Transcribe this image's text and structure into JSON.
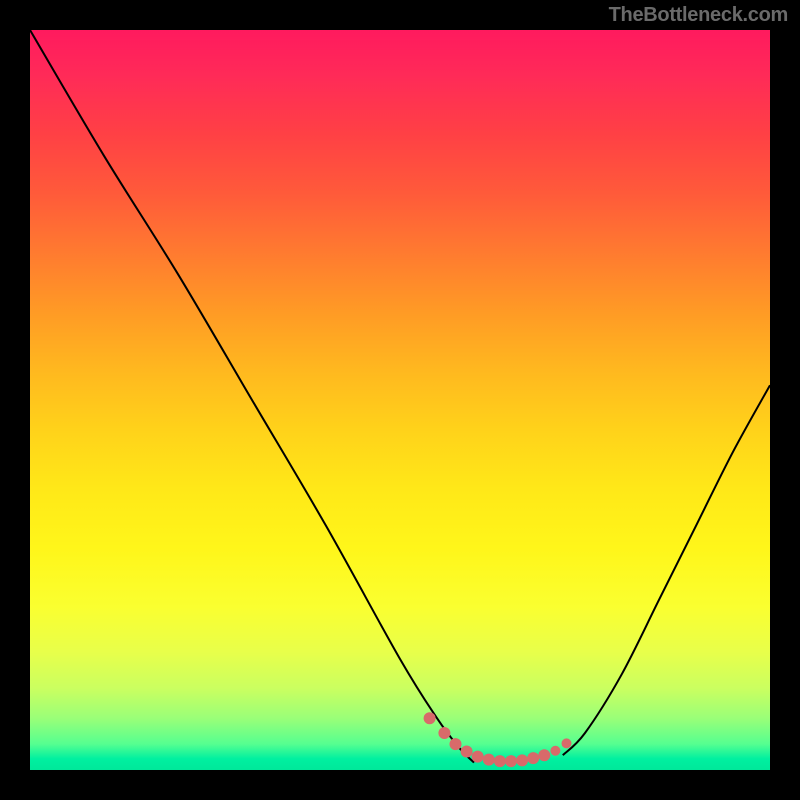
{
  "watermark": "TheBottleneck.com",
  "chart_data": {
    "type": "line",
    "title": "",
    "xlabel": "",
    "ylabel": "",
    "xlim": [
      0,
      100
    ],
    "ylim": [
      0,
      100
    ],
    "background_gradient": {
      "orientation": "vertical",
      "stops": [
        {
          "pos": 0.0,
          "color": "#ff1a5e"
        },
        {
          "pos": 0.3,
          "color": "#ff7a30"
        },
        {
          "pos": 0.62,
          "color": "#ffe818"
        },
        {
          "pos": 0.84,
          "color": "#e8ff4a"
        },
        {
          "pos": 0.965,
          "color": "#55ff90"
        },
        {
          "pos": 1.0,
          "color": "#00e89a"
        }
      ]
    },
    "series": [
      {
        "name": "left-branch",
        "x": [
          0,
          10,
          20,
          30,
          40,
          50,
          55,
          58,
          60
        ],
        "y": [
          100,
          83,
          67,
          50,
          33,
          15,
          7,
          3,
          1
        ]
      },
      {
        "name": "right-branch",
        "x": [
          72,
          75,
          80,
          85,
          90,
          95,
          100
        ],
        "y": [
          2,
          5,
          13,
          23,
          33,
          43,
          52
        ]
      }
    ],
    "dots": {
      "name": "valley-dots",
      "color": "#d86a6a",
      "points": [
        {
          "x": 54,
          "y": 7,
          "r": 6
        },
        {
          "x": 56,
          "y": 5,
          "r": 6
        },
        {
          "x": 57.5,
          "y": 3.5,
          "r": 6
        },
        {
          "x": 59,
          "y": 2.5,
          "r": 6
        },
        {
          "x": 60.5,
          "y": 1.8,
          "r": 6
        },
        {
          "x": 62,
          "y": 1.4,
          "r": 6
        },
        {
          "x": 63.5,
          "y": 1.2,
          "r": 6
        },
        {
          "x": 65,
          "y": 1.2,
          "r": 6
        },
        {
          "x": 66.5,
          "y": 1.3,
          "r": 6
        },
        {
          "x": 68,
          "y": 1.6,
          "r": 6
        },
        {
          "x": 69.5,
          "y": 2.0,
          "r": 6
        },
        {
          "x": 71,
          "y": 2.6,
          "r": 5
        },
        {
          "x": 72.5,
          "y": 3.6,
          "r": 5
        }
      ]
    }
  }
}
